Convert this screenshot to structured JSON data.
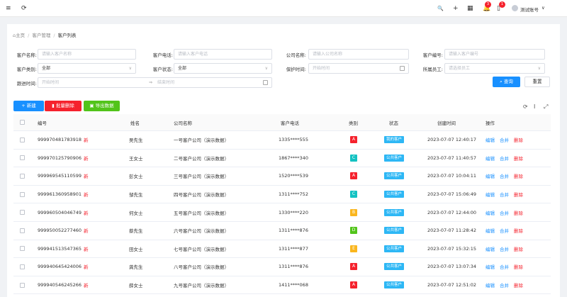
{
  "topbar": {
    "menu_icon": "≡",
    "refresh_icon": "⟳",
    "search_icon": "🔍",
    "add_icon": "+",
    "grid_icon": "▦",
    "bell_badge": "3",
    "msg_badge": "1",
    "username": "测试账号",
    "user_caret": "∨"
  },
  "breadcrumb": {
    "home": "主页",
    "level2": "客户管理",
    "current": "客户列表",
    "sep": "/"
  },
  "filters": {
    "name": {
      "label": "客户名称:",
      "placeholder": "请输入客户名称"
    },
    "phone": {
      "label": "客户电话:",
      "placeholder": "请输入客户电话"
    },
    "company": {
      "label": "公司名称:",
      "placeholder": "请输入公司名称"
    },
    "code": {
      "label": "客户编号:",
      "placeholder": "请输入客户编号"
    },
    "category": {
      "label": "客户类别:",
      "value": "全部"
    },
    "status": {
      "label": "客户状态:",
      "value": "全部"
    },
    "protect": {
      "label": "保护时间:",
      "placeholder": "开始时间"
    },
    "staff": {
      "label": "所属员工:",
      "placeholder": "请选择员工"
    },
    "followup": {
      "label": "跟进时间:",
      "start": "开始时间",
      "arrow": "⇒",
      "end": "结束时间"
    }
  },
  "buttons": {
    "search": "查询",
    "reset": "重置",
    "new": "新建",
    "batch_delete": "批量删除",
    "export": "导出数据"
  },
  "table": {
    "headers": [
      "编号",
      "姓名",
      "公司名称",
      "客户电话",
      "类别",
      "状态",
      "创建时间",
      "操作"
    ],
    "new_tag": "新",
    "ops": [
      "编辑",
      "合并",
      "删除"
    ],
    "rows": [
      {
        "code": "999970481783918",
        "name": "吴先生",
        "company": "一号客户公司（演示数据）",
        "phone": "1335****555",
        "cat": "A",
        "catColor": "#f5222d",
        "status": "我的客户",
        "time": "2023-07-07 12:40:17"
      },
      {
        "code": "999970125790906",
        "name": "王女士",
        "company": "二号客户公司（演示数据）",
        "phone": "1867****340",
        "cat": "C",
        "catColor": "#13c2c2",
        "status": "公共客户",
        "time": "2023-07-07 11:40:57"
      },
      {
        "code": "999969545110599",
        "name": "彭女士",
        "company": "三号客户公司（演示数据）",
        "phone": "1520****539",
        "cat": "A",
        "catColor": "#f5222d",
        "status": "公共客户",
        "time": "2023-07-07 10:04:11"
      },
      {
        "code": "999961360958901",
        "name": "邹先生",
        "company": "四号客户公司（演示数据）",
        "phone": "1311****752",
        "cat": "C",
        "catColor": "#13c2c2",
        "status": "公共客户",
        "time": "2023-07-07 15:06:49"
      },
      {
        "code": "999960504046749",
        "name": "何女士",
        "company": "五号客户公司（演示数据）",
        "phone": "1330****220",
        "cat": "B",
        "catColor": "#fab61e",
        "status": "公共客户",
        "time": "2023-07-07 12:44:00"
      },
      {
        "code": "999950052277460",
        "name": "蔡先生",
        "company": "六号客户公司（演示数据）",
        "phone": "1311****876",
        "cat": "D",
        "catColor": "#52c41a",
        "status": "公共客户",
        "time": "2023-07-07 11:28:42"
      },
      {
        "code": "999941513547365",
        "name": "田女士",
        "company": "七号客户公司（演示数据）",
        "phone": "1311****877",
        "cat": "E",
        "catColor": "#fab61e",
        "status": "公共客户",
        "time": "2023-07-07 15:32:15"
      },
      {
        "code": "999940645424006",
        "name": "龚先生",
        "company": "八号客户公司（演示数据）",
        "phone": "1311****876",
        "cat": "A",
        "catColor": "#f5222d",
        "status": "公共客户",
        "time": "2023-07-07 13:07:34"
      },
      {
        "code": "999940546245266",
        "name": "薛女士",
        "company": "九号客户公司（演示数据）",
        "phone": "1411****068",
        "cat": "A",
        "catColor": "#f5222d",
        "status": "公共客户",
        "time": "2023-07-07 12:51:02"
      }
    ]
  },
  "colors": {
    "primary": "#1890ff",
    "danger": "#f5222d",
    "success": "#52c41a",
    "status_tag": "#2db7f5"
  }
}
